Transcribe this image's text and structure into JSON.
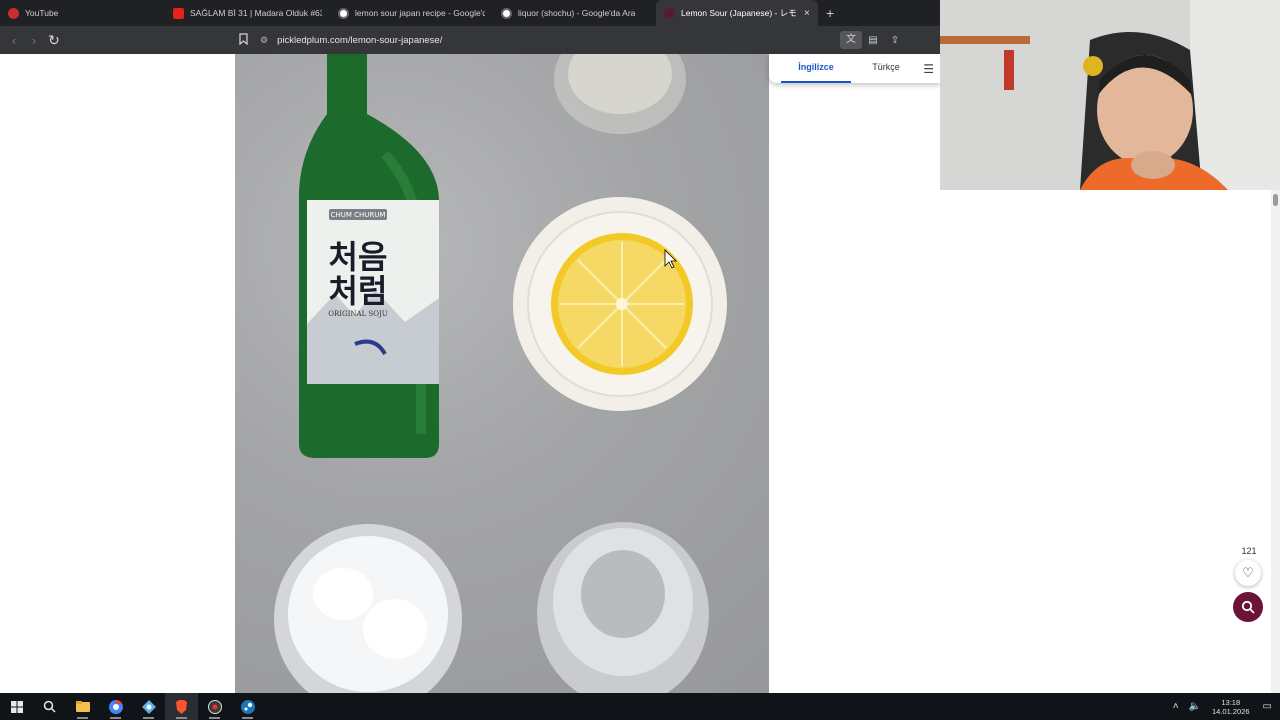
{
  "browser": {
    "tabs": [
      {
        "title": "YouTube",
        "favicon_color": "#c4302b"
      },
      {
        "title": "SAĞLAM Bİ 31 | Madara Olduk #634",
        "favicon_color": "#e62117"
      },
      {
        "title": "lemon sour japan recipe - Google'da",
        "favicon_color": "#d0d0d0"
      },
      {
        "title": "liquor (shochu) - Google'da Ara",
        "favicon_color": "#d0d0d0"
      },
      {
        "title": "Lemon Sour (Japanese) - レモンサ",
        "favicon_color": "#5a1a2e"
      }
    ],
    "new_tab": "+",
    "tab_close": "×",
    "url": "pickledplum.com/lemon-sour-japanese/"
  },
  "translate": {
    "source_lang": "İngilizce",
    "target_lang": "Türkçe"
  },
  "photo": {
    "bottle_label_top": "CHUM CHURUM",
    "bottle_label_korean_1": "처음",
    "bottle_label_korean_2": "처럼",
    "bottle_label_sub": "ORIGINAL SOJU"
  },
  "sidebar": {
    "like_count": "121"
  },
  "taskbar": {
    "time": "13:18",
    "date": "14.01.2026"
  },
  "colors": {
    "accent_fab": "#6b1436",
    "translate_active": "#1a56c8",
    "bottle_green": "#1d6b2c",
    "lemon": "#f4d44e"
  }
}
